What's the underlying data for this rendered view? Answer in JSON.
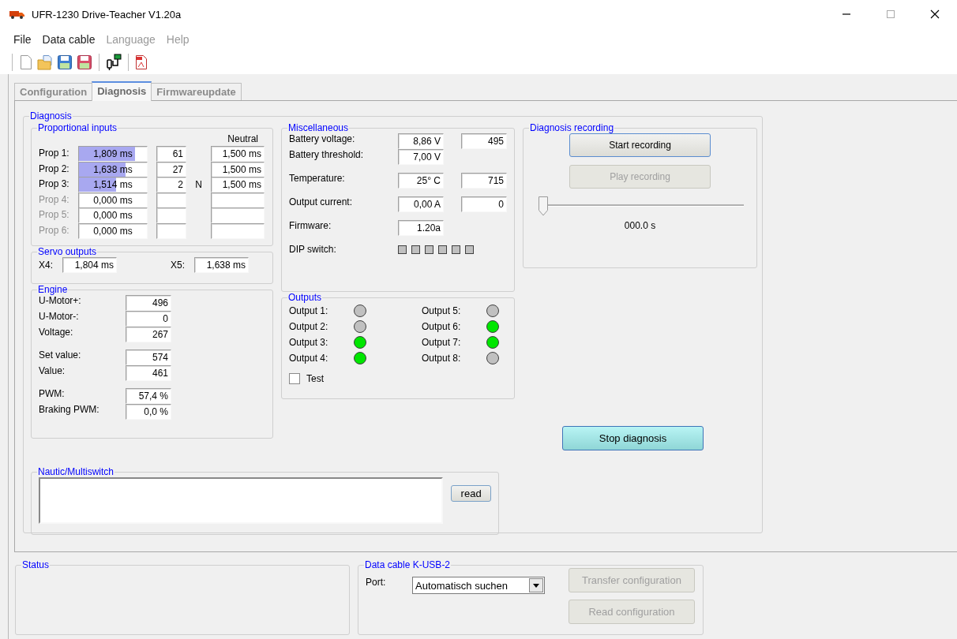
{
  "window": {
    "title": "UFR-1230 Drive-Teacher V1.20a"
  },
  "menu": [
    {
      "label": "File",
      "disabled": false
    },
    {
      "label": "Data cable",
      "disabled": false
    },
    {
      "label": "Language",
      "disabled": true
    },
    {
      "label": "Help",
      "disabled": true
    }
  ],
  "tabs": [
    {
      "label": "Configuration",
      "selected": false
    },
    {
      "label": "Diagnosis",
      "selected": true
    },
    {
      "label": "Firmwareupdate",
      "selected": false
    }
  ],
  "diagnosis": {
    "title": "Diagnosis",
    "proportional_inputs": {
      "title": "Proportional inputs",
      "neutral_header": "Neutral",
      "rows": [
        {
          "label": "Prop 1:",
          "active": true,
          "value": "1,809 ms",
          "level": 0.83,
          "count": "61",
          "neutral": "1,500 ms"
        },
        {
          "label": "Prop 2:",
          "active": true,
          "value": "1,638 ms",
          "level": 0.69,
          "count": "27",
          "neutral": "1,500 ms"
        },
        {
          "label": "Prop 3:",
          "active": true,
          "value": "1,514 ms",
          "level": 0.55,
          "count": "2",
          "marker": "N",
          "neutral": "1,500 ms"
        },
        {
          "label": "Prop 4:",
          "active": false,
          "value": "0,000 ms"
        },
        {
          "label": "Prop 5:",
          "active": false,
          "value": "0,000 ms"
        },
        {
          "label": "Prop 6:",
          "active": false,
          "value": "0,000 ms"
        }
      ]
    },
    "servo_outputs": {
      "title": "Servo outputs",
      "items": [
        {
          "label": "X4:",
          "value": "1,804 ms"
        },
        {
          "label": "X5:",
          "value": "1,638 ms"
        }
      ]
    },
    "engine": {
      "title": "Engine",
      "groups": [
        {
          "rows": [
            {
              "label": "U-Motor+:",
              "value": "496"
            },
            {
              "label": "U-Motor-:",
              "value": "0"
            },
            {
              "label": "Voltage:",
              "value": "267"
            }
          ]
        },
        {
          "rows": [
            {
              "label": "Set value:",
              "value": "574"
            },
            {
              "label": "Value:",
              "value": "461"
            }
          ]
        },
        {
          "rows": [
            {
              "label": "PWM:",
              "value": "57,4 %"
            },
            {
              "label": "Braking PWM:",
              "value": "0,0 %"
            }
          ]
        }
      ]
    },
    "miscellaneous": {
      "title": "Miscellaneous",
      "groups": [
        {
          "rows": [
            {
              "label": "Battery voltage:",
              "value": "8,86 V",
              "raw": "495"
            },
            {
              "label": "Battery threshold:",
              "value": "7,00 V"
            }
          ]
        },
        {
          "rows": [
            {
              "label": "Temperature:",
              "value": "25° C",
              "raw": "715"
            }
          ]
        },
        {
          "rows": [
            {
              "label": "Output current:",
              "value": "0,00 A",
              "raw": "0"
            }
          ]
        },
        {
          "rows": [
            {
              "label": "Firmware:",
              "value": "1.20a"
            }
          ]
        }
      ],
      "dip_switch": {
        "label": "DIP switch:",
        "switches": [
          {
            "on": false
          },
          {
            "on": false
          },
          {
            "on": false
          },
          {
            "on": false
          },
          {
            "on": false
          },
          {
            "on": false
          }
        ]
      }
    },
    "outputs": {
      "title": "Outputs",
      "items": [
        {
          "label": "Output 1:",
          "on": false
        },
        {
          "label": "Output 2:",
          "on": false
        },
        {
          "label": "Output 3:",
          "on": true
        },
        {
          "label": "Output 4:",
          "on": true
        },
        {
          "label": "Output 5:",
          "on": false
        },
        {
          "label": "Output 6:",
          "on": true
        },
        {
          "label": "Output 7:",
          "on": true
        },
        {
          "label": "Output 8:",
          "on": false
        }
      ],
      "test": {
        "label": "Test",
        "checked": false
      }
    },
    "recording": {
      "title": "Diagnosis recording",
      "buttons": [
        {
          "label": "Start recording",
          "disabled": false
        },
        {
          "label": "Play recording",
          "disabled": true
        }
      ],
      "slider": {
        "level": 0
      },
      "time": "000.0 s"
    },
    "stop_button": "Stop diagnosis",
    "nautic": {
      "title": "Nautic/Multiswitch",
      "read_button": "read"
    }
  },
  "status": {
    "title": "Status"
  },
  "data_cable": {
    "title": "Data cable K-USB-2",
    "port_label": "Port:",
    "port_value": "Automatisch suchen",
    "buttons": [
      {
        "label": "Transfer configuration",
        "disabled": true
      },
      {
        "label": "Read configuration",
        "disabled": true
      }
    ]
  }
}
